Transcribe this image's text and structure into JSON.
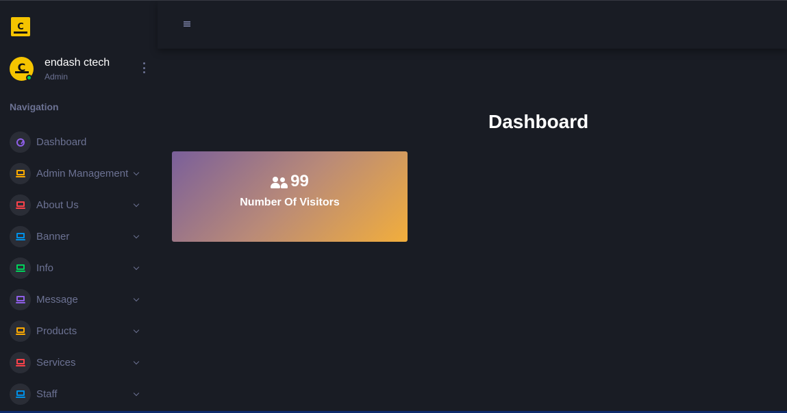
{
  "brand": {
    "logo_text": "C"
  },
  "profile": {
    "name": "endash ctech",
    "role": "Admin",
    "avatar_text": "C"
  },
  "sidebar": {
    "heading": "Navigation",
    "items": [
      {
        "label": "Dashboard",
        "icon": "speedometer-icon",
        "color": "#8f5fe8",
        "has_submenu": false
      },
      {
        "label": "Admin Management",
        "icon": "laptop-icon",
        "color": "#ffab00",
        "has_submenu": true
      },
      {
        "label": "About Us",
        "icon": "laptop-icon",
        "color": "#fc424a",
        "has_submenu": true
      },
      {
        "label": "Banner",
        "icon": "laptop-icon",
        "color": "#0090e7",
        "has_submenu": true
      },
      {
        "label": "Info",
        "icon": "laptop-icon",
        "color": "#00d25b",
        "has_submenu": true
      },
      {
        "label": "Message",
        "icon": "laptop-icon",
        "color": "#8f5fe8",
        "has_submenu": true
      },
      {
        "label": "Products",
        "icon": "laptop-icon",
        "color": "#ffab00",
        "has_submenu": true
      },
      {
        "label": "Services",
        "icon": "laptop-icon",
        "color": "#fc424a",
        "has_submenu": true
      },
      {
        "label": "Staff",
        "icon": "laptop-icon",
        "color": "#0090e7",
        "has_submenu": true
      }
    ]
  },
  "navbar": {
    "menu_icon": "hamburger-icon"
  },
  "main": {
    "title": "Dashboard",
    "stat_card": {
      "icon": "users-icon",
      "value": "99",
      "label": "Number Of Visitors"
    }
  },
  "colors": {
    "background": "#191c24",
    "muted_text": "#6c7293",
    "online": "#00d25b",
    "brand_yellow": "#f5c400",
    "card_gradient_start": "#7a5f9a",
    "card_gradient_end": "#f2ae3c"
  }
}
